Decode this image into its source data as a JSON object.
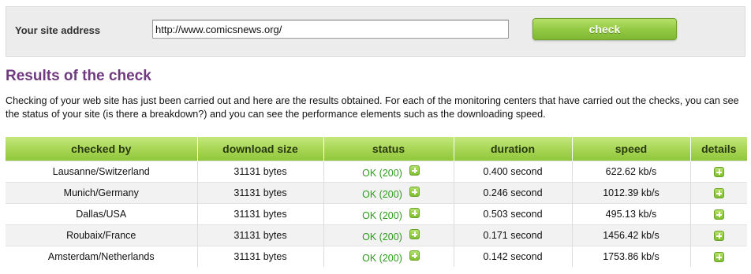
{
  "check_form": {
    "label": "Your site address",
    "url_value": "http://www.comicsnews.org/",
    "button_label": "check"
  },
  "results": {
    "title": "Results of the check",
    "intro": "Checking of your web site has just been carried out and here are the results obtained. For each of the monitoring centers that have carried out the checks, you can see the status of your site (is there a breakdown?) and you can see the performance elements such as the downloading speed.",
    "columns": [
      "checked by",
      "download size",
      "status",
      "duration",
      "speed",
      "details"
    ],
    "rows": [
      {
        "location": "Lausanne/Switzerland",
        "size": "31131 bytes",
        "status": "OK (200)",
        "duration": "0.400 second",
        "speed": "622.62 kb/s"
      },
      {
        "location": "Munich/Germany",
        "size": "31131 bytes",
        "status": "OK (200)",
        "duration": "0.246 second",
        "speed": "1012.39 kb/s"
      },
      {
        "location": "Dallas/USA",
        "size": "31131 bytes",
        "status": "OK (200)",
        "duration": "0.503 second",
        "speed": "495.13 kb/s"
      },
      {
        "location": "Roubaix/France",
        "size": "31131 bytes",
        "status": "OK (200)",
        "duration": "0.171 second",
        "speed": "1456.42 kb/s"
      },
      {
        "location": "Amsterdam/Netherlands",
        "size": "31131 bytes",
        "status": "OK (200)",
        "duration": "0.142 second",
        "speed": "1753.86 kb/s"
      }
    ]
  },
  "icons": {
    "expand": "plus-icon"
  },
  "colors": {
    "title": "#6f3a7f",
    "header_green": "#a6d553",
    "status_ok": "#2f9a1e",
    "button_green": "#94c944"
  }
}
